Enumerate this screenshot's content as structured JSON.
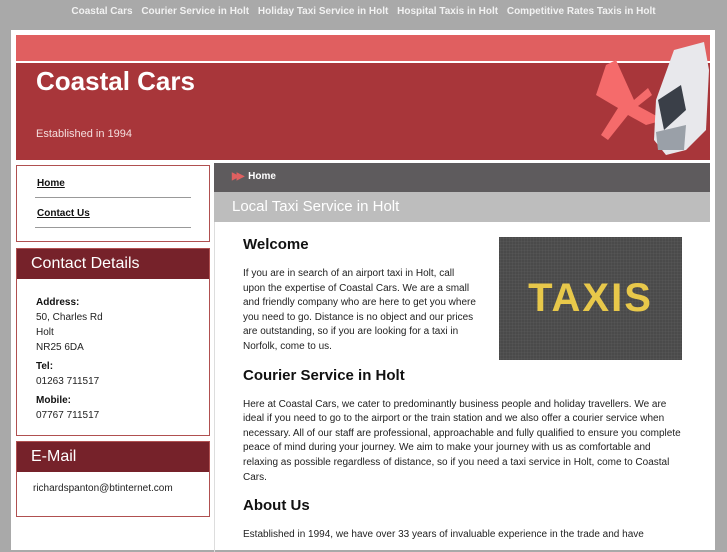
{
  "topnav": [
    "Coastal Cars",
    "Courier Service in Holt",
    "Holiday Taxi Service in Holt",
    "Hospital Taxis in Holt",
    "Competitive Rates Taxis in Holt"
  ],
  "header": {
    "title": "Coastal Cars",
    "tagline": "Established in 1994"
  },
  "sidebar": {
    "nav": [
      "Home",
      "Contact Us"
    ],
    "contact": {
      "heading": "Contact Details",
      "address_label": "Address:",
      "address": [
        "50, Charles Rd",
        "Holt",
        "NR25 6DA"
      ],
      "tel_label": "Tel:",
      "tel": "01263 711517",
      "mobile_label": "Mobile:",
      "mobile": "07767 711517"
    },
    "email": {
      "heading": "E-Mail",
      "address": "richardspanton@btinternet.com"
    }
  },
  "breadcrumb": "Home",
  "page_title": "Local Taxi Service in Holt",
  "content": {
    "image_text": "TAXIS",
    "sections": [
      {
        "heading": "Welcome",
        "text": "If you are in search of an airport taxi in Holt, call upon the expertise of Coastal Cars. We are a small and friendly company who are here to get you where you need to go. Distance is no object and our prices are outstanding, so if you are looking for a taxi in Norfolk, come to us."
      },
      {
        "heading": "Courier Service in Holt",
        "text": "Here at Coastal Cars, we cater to predominantly business people and holiday travellers. We are ideal if you need to go to the airport or the train station and we also offer a courier service when necessary. All of our staff are professional, approachable and fully qualified to ensure you complete peace of mind during your journey. We aim to make your journey with us as comfortable and relaxing as possible regardless of distance, so if you need a taxi service in Holt, come to Coastal Cars."
      },
      {
        "heading": "About Us",
        "text": "Established in 1994, we have over 33 years of invaluable experience in the trade and have"
      }
    ]
  }
}
